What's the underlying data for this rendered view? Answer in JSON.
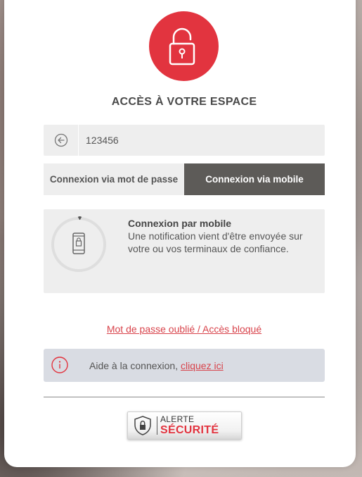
{
  "header": {
    "icon": "unlock-icon",
    "title": "ACCÈS À VOTRE ESPACE"
  },
  "login": {
    "back_icon": "arrow-left-circle-icon",
    "user_id_value": "123456"
  },
  "tabs": [
    {
      "label": "Connexion via mot de passe",
      "active": false
    },
    {
      "label": "Connexion via mobile",
      "active": true
    }
  ],
  "mobile_panel": {
    "icon": "smartphone-lock-icon",
    "title": "Connexion par mobile",
    "text": "Une notification vient d'être envoyée sur votre ou vos terminaux de confiance."
  },
  "forgot_link": "Mot de passe oublié / Accès bloqué",
  "help": {
    "icon": "info-icon",
    "text": "Aide à la connexion, ",
    "link": "cliquez ici"
  },
  "badge": {
    "icon": "shield-lock-icon",
    "line1": "ALERTE",
    "line2": "SÉCURITÉ"
  },
  "colors": {
    "accent_red": "#e2343f",
    "active_tab": "#5d5b58",
    "field_bg": "#eeeeee",
    "help_bg": "#d9dce3"
  }
}
